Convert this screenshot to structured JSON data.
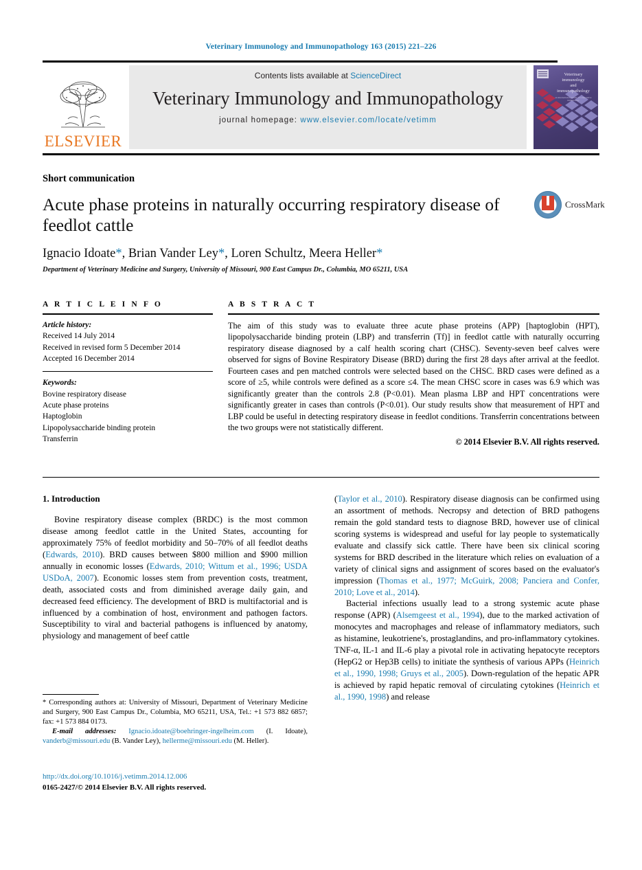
{
  "running_head": "Veterinary Immunology and Immunopathology 163 (2015) 221–226",
  "masthead": {
    "contents_prefix": "Contents lists available at ",
    "sciencedirect": "ScienceDirect",
    "journal_title": "Veterinary Immunology and Immunopathology",
    "homepage_label": "journal homepage:",
    "homepage_url": "www.elsevier.com/locate/vetimm",
    "publisher": "ELSEVIER",
    "cover": {
      "line1": "Veterinary",
      "line2": "immunology",
      "line3": "and",
      "line4": "immunopathology",
      "subtitle": "an international journal of comparative immunology"
    }
  },
  "article": {
    "section_type": "Short communication",
    "title": "Acute phase proteins in naturally occurring respiratory disease of feedlot cattle",
    "authors": "Ignacio Idoate*, Brian Vander Ley*, Loren Schultz, Meera Heller*",
    "affiliation": "Department of Veterinary Medicine and Surgery, University of Missouri, 900 East Campus Dr., Columbia, MO 65211, USA",
    "crossmark_label": "CrossMark"
  },
  "info": {
    "heading": "A R T I C L E   I N F O",
    "history_label": "Article history:",
    "history": [
      "Received 14 July 2014",
      "Received in revised form 5 December 2014",
      "Accepted 16 December 2014"
    ],
    "keywords_label": "Keywords:",
    "keywords": [
      "Bovine respiratory disease",
      "Acute phase proteins",
      "Haptoglobin",
      "Lipopolysaccharide binding protein",
      "Transferrin"
    ]
  },
  "abstract": {
    "heading": "A B S T R A C T",
    "text": "The aim of this study was to evaluate three acute phase proteins (APP) [haptoglobin (HPT), lipopolysaccharide binding protein (LBP) and transferrin (Tf)] in feedlot cattle with naturally occurring respiratory disease diagnosed by a calf health scoring chart (CHSC). Seventy-seven beef calves were observed for signs of Bovine Respiratory Disease (BRD) during the first 28 days after arrival at the feedlot. Fourteen cases and pen matched controls were selected based on the CHSC. BRD cases were defined as a score of ≥5, while controls were defined as a score ≤4. The mean CHSC score in cases was 6.9 which was significantly greater than the controls 2.8 (P<0.01). Mean plasma LBP and HPT concentrations were significantly greater in cases than controls (P<0.01). Our study results show that measurement of HPT and LBP could be useful in detecting respiratory disease in feedlot conditions. Transferrin concentrations between the two groups were not statistically different.",
    "copyright": "© 2014 Elsevier B.V. All rights reserved."
  },
  "body": {
    "intro_heading": "1. Introduction",
    "left_p1_a": "Bovine respiratory disease complex (BRDC) is the most common disease among feedlot cattle in the United States, accounting for approximately 75% of feedlot morbidity and 50–70% of all feedlot deaths (",
    "left_cite1": "Edwards, 2010",
    "left_p1_b": "). BRD causes between $800 million and $900 million annually in economic losses (",
    "left_cite2": "Edwards, 2010; Wittum et al., 1996; USDA USDoA, 2007",
    "left_p1_c": "). Economic losses stem from prevention costs, treatment, death, associated costs and from diminished average daily gain, and decreased feed efficiency. The development of BRD is multifactorial and is influenced by a combination of host, environment and pathogen factors. Susceptibility to viral and bacterial pathogens is influenced by anatomy, physiology and management of beef cattle",
    "right_p1_a": "(",
    "right_cite1": "Taylor et al., 2010",
    "right_p1_b": "). Respiratory disease diagnosis can be confirmed using an assortment of methods. Necropsy and detection of BRD pathogens remain the gold standard tests to diagnose BRD, however use of clinical scoring systems is widespread and useful for lay people to systematically evaluate and classify sick cattle. There have been six clinical scoring systems for BRD described in the literature which relies on evaluation of a variety of clinical signs and assignment of scores based on the evaluator's impression (",
    "right_cite2": "Thomas et al., 1977; McGuirk, 2008; Panciera and Confer, 2010; Love et al., 2014",
    "right_p1_c": ").",
    "right_p2_a": "Bacterial infections usually lead to a strong systemic acute phase response (APR) (",
    "right_cite3": "Alsemgeest et al., 1994",
    "right_p2_b": "), due to the marked activation of monocytes and macrophages and release of inflammatory mediators, such as histamine, leukotriene's, prostaglandins, and pro-inflammatory cytokines. TNF-α, IL-1 and IL-6 play a pivotal role in activating hepatocyte receptors (HepG2 or Hep3B cells) to initiate the synthesis of various APPs (",
    "right_cite4": "Heinrich et al., 1990, 1998; Gruys et al., 2005",
    "right_p2_c": "). Down-regulation of the hepatic APR is achieved by rapid hepatic removal of circulating cytokines (",
    "right_cite5": "Heinrich et al., 1990, 1998",
    "right_p2_d": ") and release"
  },
  "footnotes": {
    "corresponding": "* Corresponding authors at: University of Missouri, Department of Veterinary Medicine and Surgery, 900 East Campus Dr., Columbia, MO 65211, USA, Tel.: +1 573 882 6857; fax: +1 573 884 0173.",
    "email_label": "E-mail addresses:",
    "email1": "Ignacio.idoate@boehringer-ingelheim.com",
    "email1_owner": " (I. Idoate), ",
    "email2": "vanderb@missouri.edu",
    "email2_owner": " (B. Vander Ley), ",
    "email3": "hellerme@missouri.edu",
    "email3_owner": " (M. Heller).",
    "doi": "http://dx.doi.org/10.1016/j.vetimm.2014.12.006",
    "issn": "0165-2427/© 2014 Elsevier B.V. All rights reserved."
  }
}
